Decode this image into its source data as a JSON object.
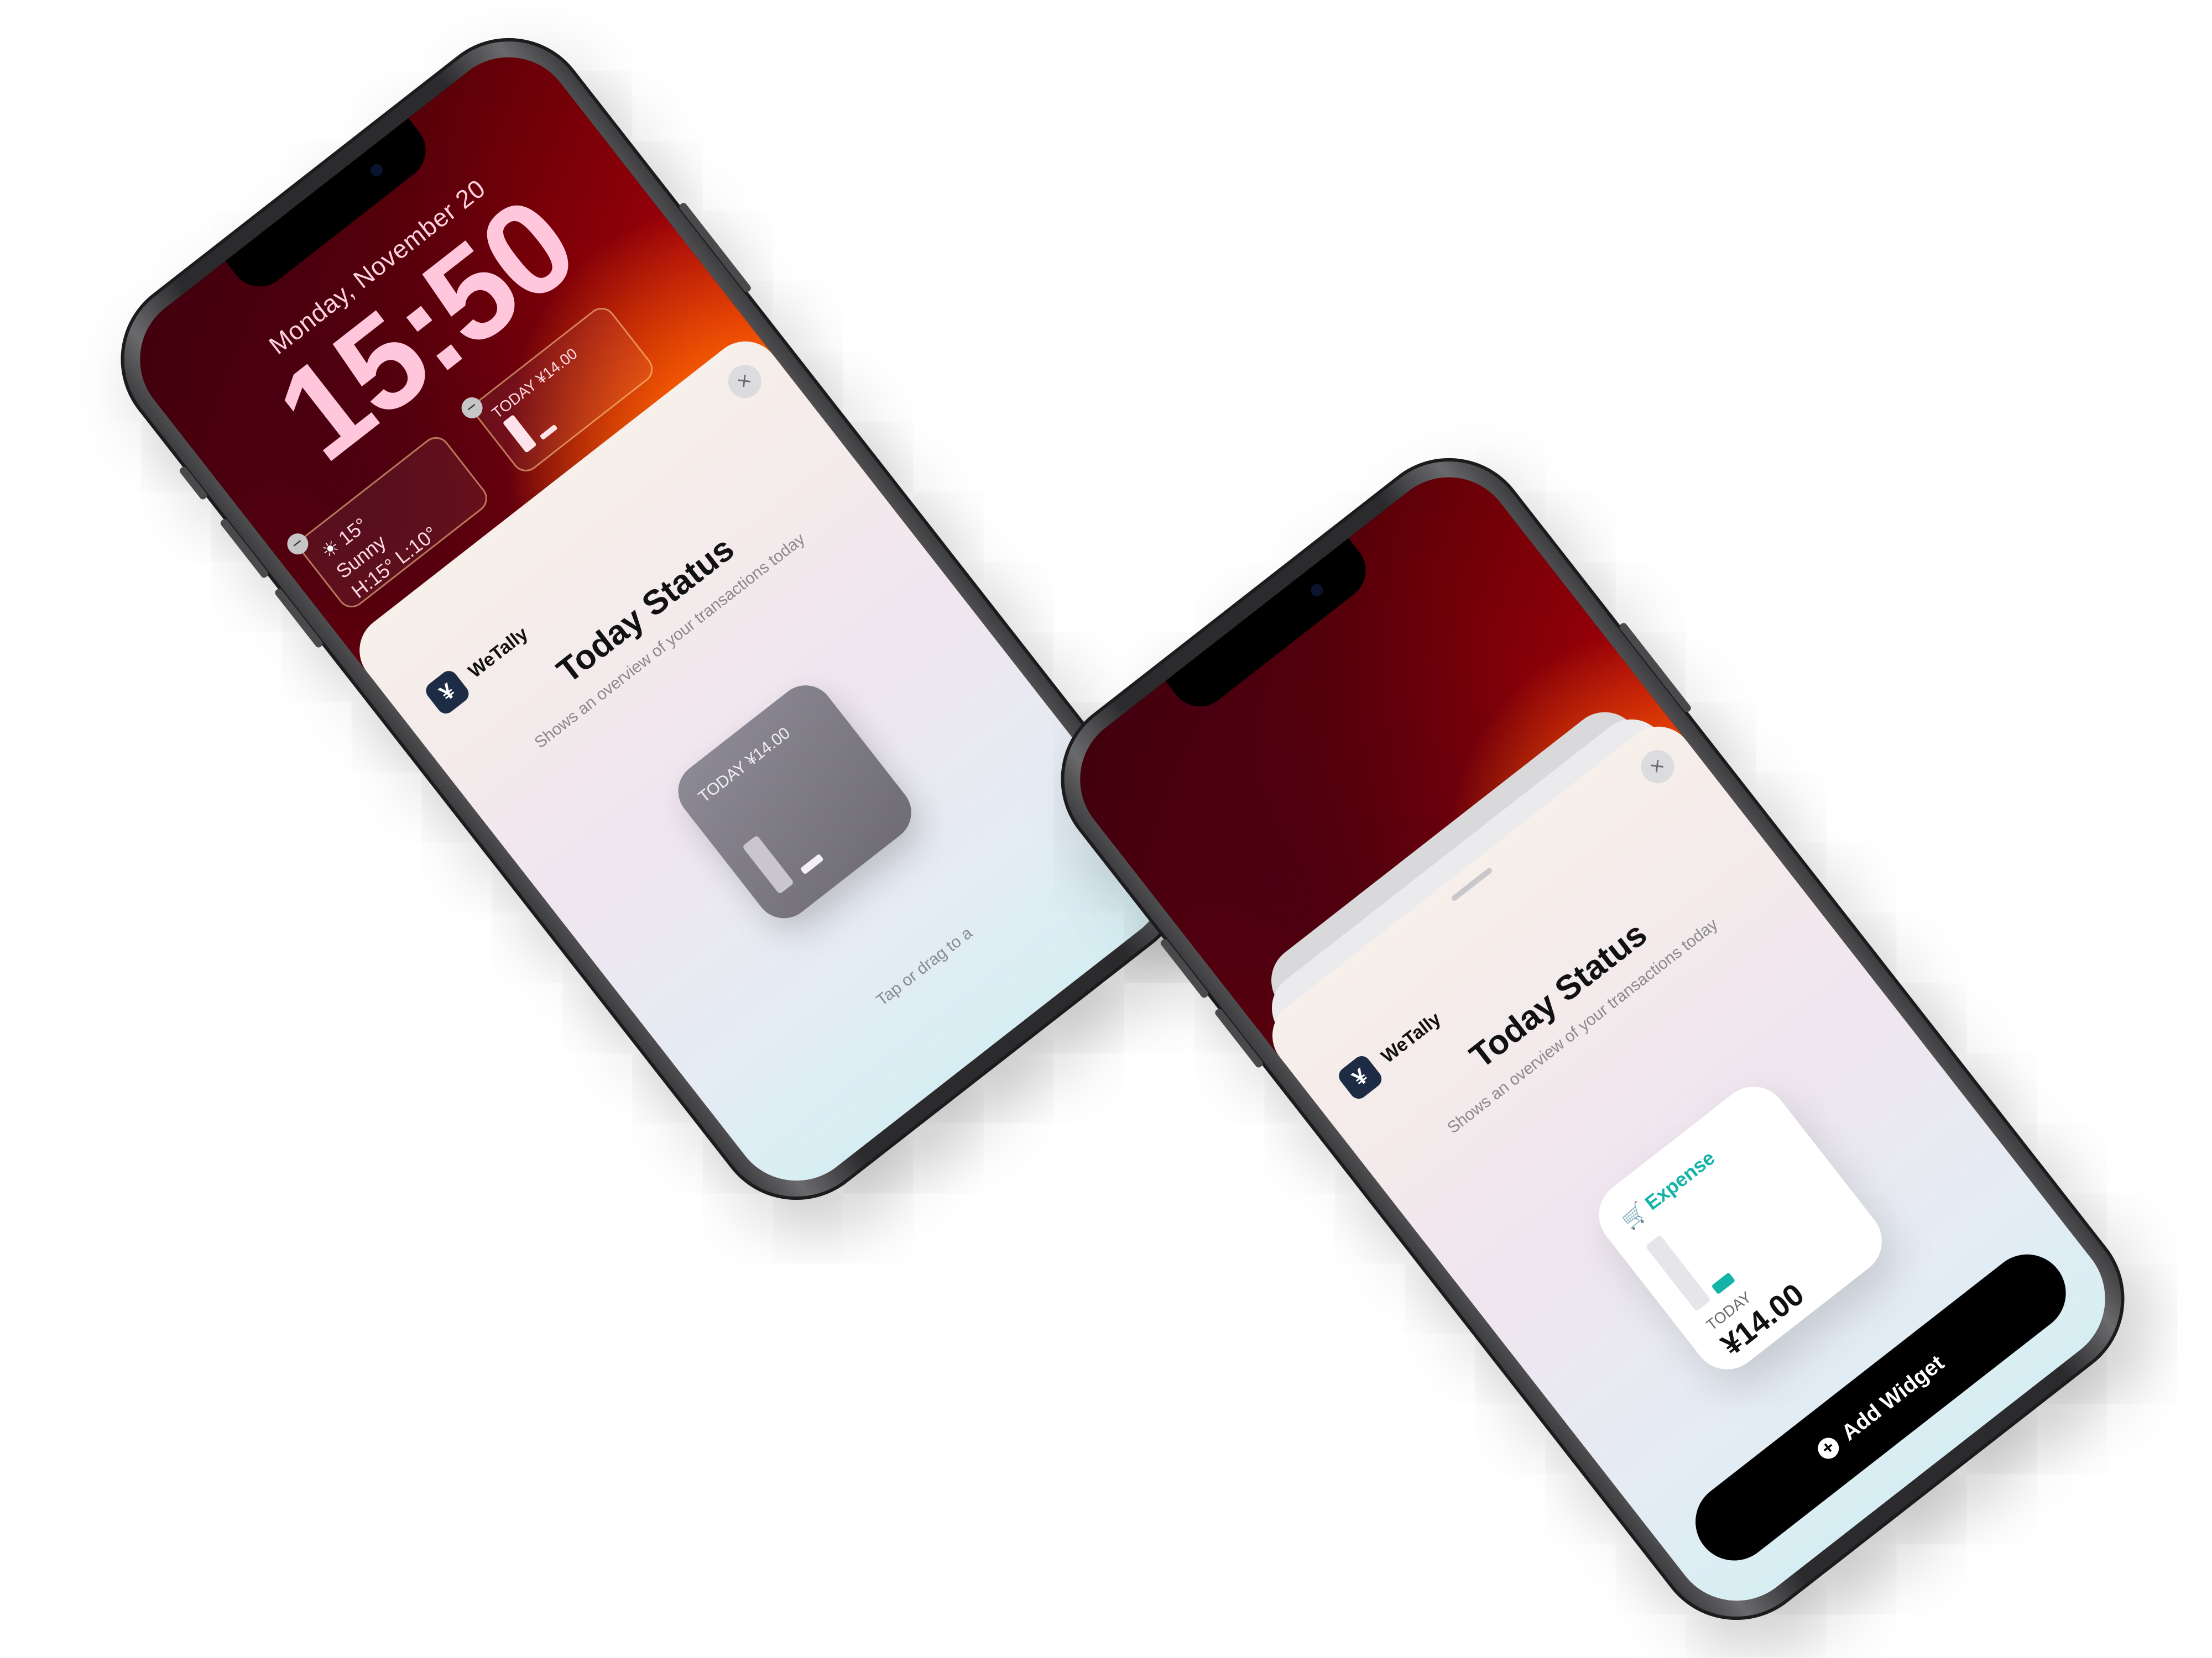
{
  "lockscreen": {
    "date": "Monday, November 20",
    "time": "15:50",
    "weather": {
      "icon": "sun-icon",
      "temp": "15°",
      "condition": "Sunny",
      "range": "H:15° L:10°"
    },
    "today_widget": {
      "label": "TODAY ¥14.00"
    }
  },
  "gallery_left": {
    "app_icon_glyph": "¥",
    "app_name": "WeTally",
    "title": "Today Status",
    "description": "Shows an overview of your transactions today",
    "preview_label": "TODAY ¥14.00",
    "hint": "Tap or drag to a"
  },
  "gallery_right": {
    "app_icon_glyph": "¥",
    "app_name": "WeTally",
    "title": "Today Status",
    "description": "Shows an overview of your transactions today",
    "preview": {
      "category": "Expense",
      "category_icon": "cart-icon",
      "today": "TODAY",
      "amount": "¥14.00"
    },
    "add_button": "Add Widget"
  },
  "close_glyph": "×",
  "colors": {
    "accent_teal": "#14b3a8",
    "wallpaper_red": "#e70010",
    "wallpaper_orange": "#ff6a00",
    "app_icon_navy": "#1d2b44"
  }
}
